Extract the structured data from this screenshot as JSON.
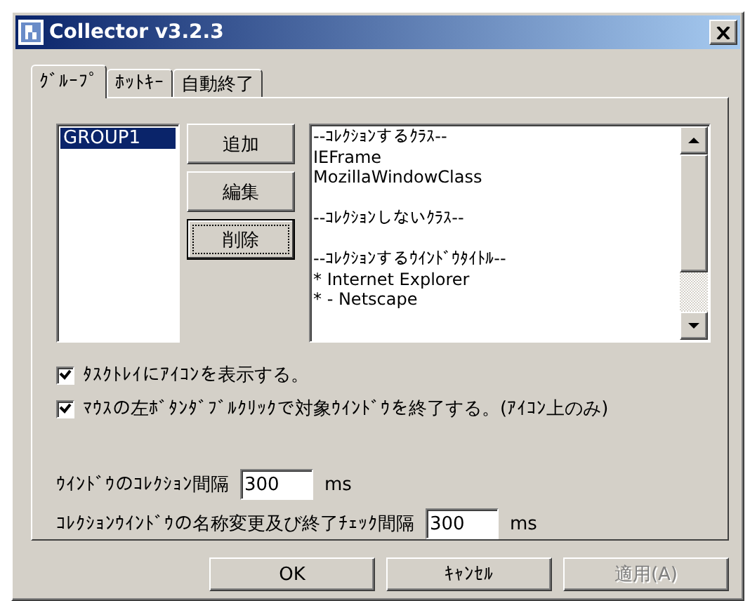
{
  "window": {
    "title": "Collector v3.2.3"
  },
  "tabs": [
    {
      "label": "ｸﾞﾙｰﾌﾟ",
      "selected": true
    },
    {
      "label": "ﾎｯﾄｷｰ",
      "selected": false
    },
    {
      "label": "自動終了",
      "selected": false
    }
  ],
  "groups": [
    {
      "label": "GROUP1",
      "selected": true
    }
  ],
  "group_buttons": [
    {
      "label": "追加",
      "focused": false
    },
    {
      "label": "編集",
      "focused": false
    },
    {
      "label": "削除",
      "focused": true
    }
  ],
  "rules": [
    {
      "header": "--ｺﾚｸｼｮﾝするｸﾗｽ--",
      "items": [
        "IEFrame",
        "MozillaWindowClass"
      ]
    },
    {
      "header": "--ｺﾚｸｼｮﾝしないｸﾗｽ--"
    },
    {
      "header": "--ｺﾚｸｼｮﾝするｳｲﾝﾄﾞｳﾀｲﾄﾙ--",
      "items": [
        "* Internet Explorer",
        "* - Netscape"
      ]
    }
  ],
  "options": [
    {
      "label": "ﾀｽｸﾄﾚｲにｱｲｺﾝを表示する。",
      "checked": true
    },
    {
      "label": "ﾏｳｽの左ﾎﾞﾀﾝﾀﾞﾌﾞﾙｸﾘｯｸで対象ｳｲﾝﾄﾞｳを終了する。(ｱｲｺﾝ上のみ)",
      "checked": true
    }
  ],
  "intervals": [
    {
      "label": "ｳｲﾝﾄﾞｳのｺﾚｸｼｮﾝ間隔",
      "value": "300",
      "unit": "ms"
    },
    {
      "label": "ｺﾚｸｼｮﾝｳｲﾝﾄﾞｳの名称変更及び終了ﾁｪｯｸ間隔",
      "value": "300",
      "unit": "ms"
    }
  ],
  "buttons": [
    {
      "label": "OK",
      "disabled": false
    },
    {
      "label": "ｷｬﾝｾﾙ",
      "disabled": false
    },
    {
      "label": "適用(A)",
      "disabled": true
    }
  ]
}
